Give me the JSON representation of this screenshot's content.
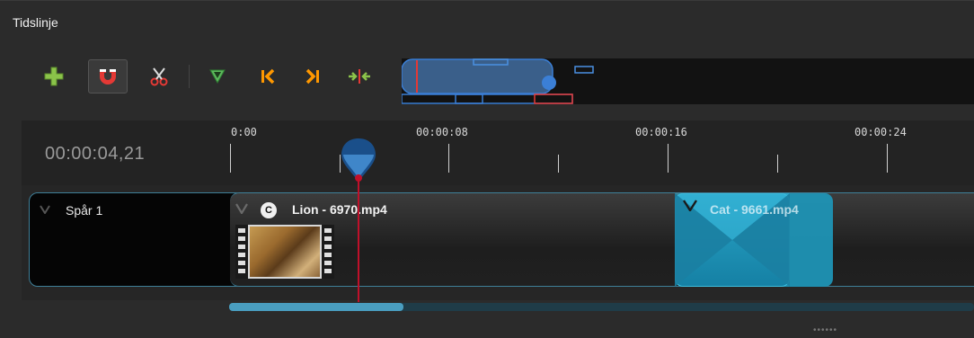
{
  "panel": {
    "title": "Tidslinje"
  },
  "toolbar": {
    "add_track": "add-track",
    "snapping": "snapping-magnet",
    "razor": "razor",
    "add_marker": "add-marker",
    "prev_marker": "previous-marker",
    "next_marker": "next-marker",
    "center_playhead": "center-on-playhead"
  },
  "ruler": {
    "timecode": "00:00:04,21",
    "ticks": [
      "0:00",
      "00:00:08",
      "00:00:16",
      "00:00:24"
    ]
  },
  "tracks": [
    {
      "name": "Spår 1",
      "clips": [
        {
          "label": "Lion - 6970.mp4",
          "badge": "C"
        },
        {
          "label": "Cat - 9661.mp4"
        }
      ]
    }
  ],
  "colors": {
    "accent": "#3f7f98",
    "playhead": "#c0102a",
    "selected_clip": "#1f93b5"
  }
}
